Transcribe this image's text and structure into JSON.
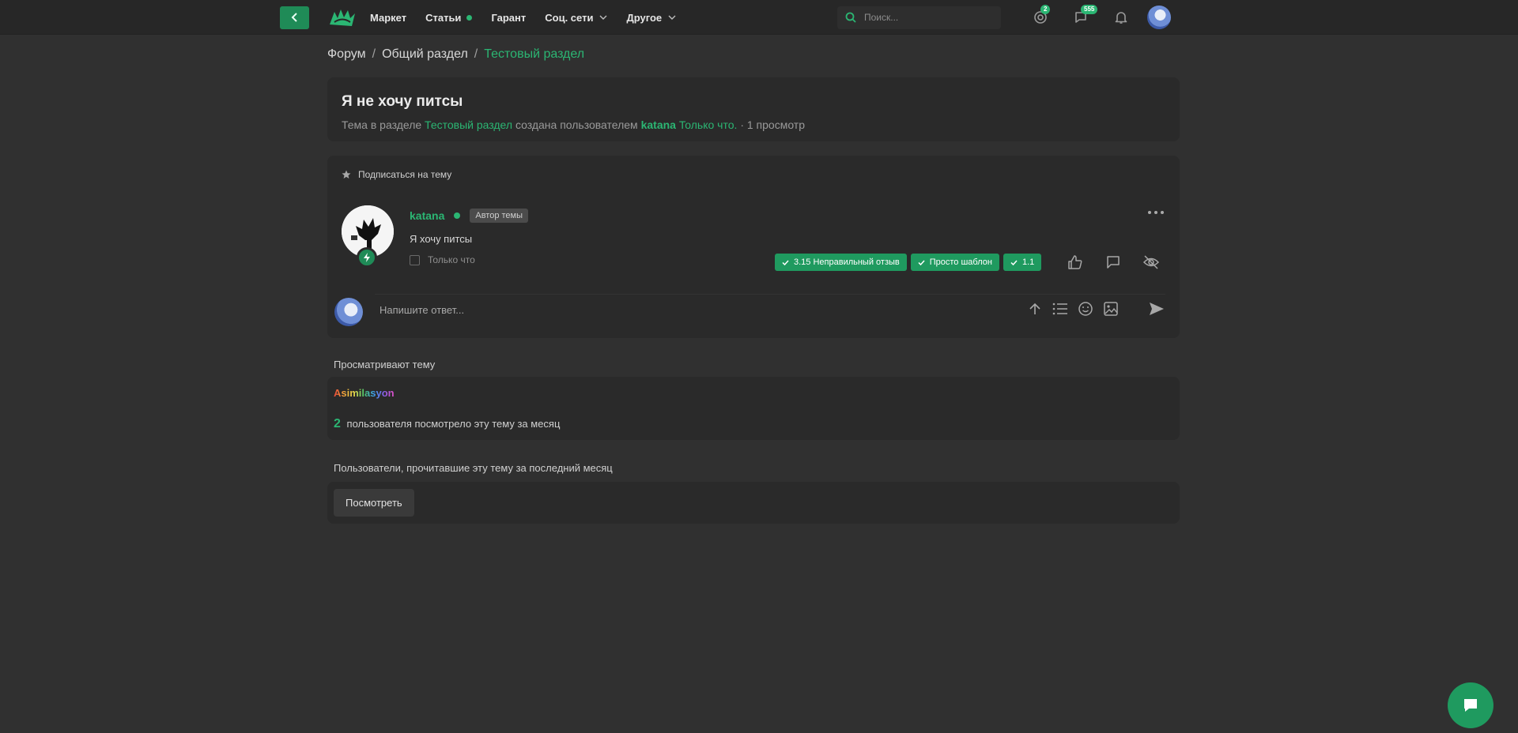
{
  "topbar": {
    "nav": [
      {
        "label": "Маркет"
      },
      {
        "label": "Статьи"
      },
      {
        "label": "Гарант"
      },
      {
        "label": "Соц. сети"
      },
      {
        "label": "Другое"
      }
    ],
    "search_placeholder": "Поиск...",
    "alerts_badge": "2",
    "messages_badge": "555"
  },
  "breadcrumb": {
    "forum": "Форум",
    "sep": "/",
    "general": "Общий раздел",
    "current": "Тестовый раздел"
  },
  "thread": {
    "title": "Я не хочу питсы",
    "meta_prefix": "Тема в разделе",
    "section": "Тестовый раздел",
    "meta_created": "создана пользователем",
    "author": "katana",
    "time": "Только что.",
    "views": "· 1 просмотр"
  },
  "post": {
    "subscribe": "Подписаться на тему",
    "author": "katana",
    "author_tag": "Автор темы",
    "text": "Я хочу питсы",
    "time": "Только что",
    "reactions": [
      {
        "label": "3.15 Неправильный отзыв"
      },
      {
        "label": "Просто шаблон"
      },
      {
        "label": "1.1"
      }
    ]
  },
  "reply": {
    "placeholder": "Напишите ответ..."
  },
  "viewers": {
    "label": "Просматривают тему",
    "name": "Asimilasyon",
    "count": "2",
    "count_text": "пользователя посмотрело эту тему за месяц"
  },
  "readers": {
    "label": "Пользователи, прочитавшие эту тему за последний месяц",
    "button": "Посмотреть"
  },
  "colors": {
    "accent": "#2bb673",
    "background": "#303030",
    "card": "#2a2a2a"
  }
}
